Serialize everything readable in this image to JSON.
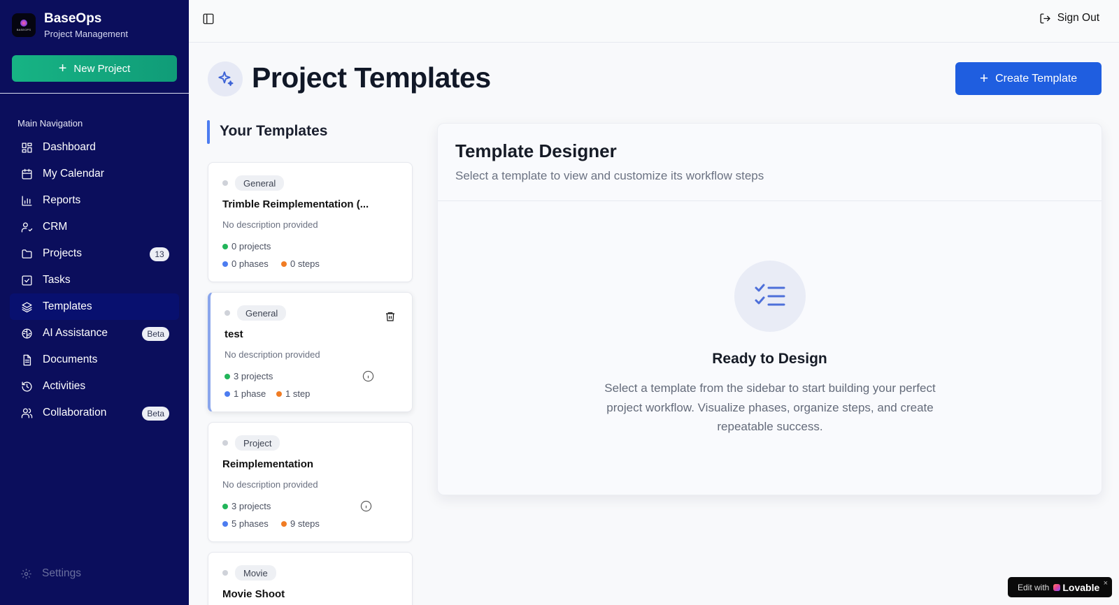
{
  "app": {
    "name": "BaseOps",
    "subtitle": "Project Management",
    "logo_text": "BASEOPS"
  },
  "sidebar": {
    "new_project_label": "New Project",
    "nav_heading": "Main Navigation",
    "items": [
      {
        "label": "Dashboard",
        "icon": "dashboard-icon"
      },
      {
        "label": "My Calendar",
        "icon": "calendar-icon"
      },
      {
        "label": "Reports",
        "icon": "bar-chart-icon"
      },
      {
        "label": "CRM",
        "icon": "user-check-icon"
      },
      {
        "label": "Projects",
        "icon": "folder-icon",
        "badge": "13"
      },
      {
        "label": "Tasks",
        "icon": "checkbox-icon"
      },
      {
        "label": "Templates",
        "icon": "layers-icon",
        "active": true
      },
      {
        "label": "AI Assistance",
        "icon": "brain-icon",
        "badge": "Beta"
      },
      {
        "label": "Documents",
        "icon": "document-icon"
      },
      {
        "label": "Activities",
        "icon": "history-icon"
      },
      {
        "label": "Collaboration",
        "icon": "users-icon",
        "badge": "Beta"
      }
    ],
    "settings_label": "Settings"
  },
  "topbar": {
    "sign_out_label": "Sign Out"
  },
  "page": {
    "title": "Project Templates",
    "create_button_label": "Create Template",
    "section_title": "Your Templates"
  },
  "templates": [
    {
      "tag": "General",
      "name": "Trimble Reimplementation (...",
      "description": "No description provided",
      "projects": "0 projects",
      "phases": "0 phases",
      "steps": "0 steps"
    },
    {
      "tag": "General",
      "name": "test",
      "description": "No description provided",
      "projects": "3 projects",
      "phases": "1 phase",
      "steps": "1 step",
      "selected": true
    },
    {
      "tag": "Project",
      "name": "Reimplementation",
      "description": "No description provided",
      "projects": "3 projects",
      "phases": "5 phases",
      "steps": "9 steps"
    },
    {
      "tag": "Movie",
      "name": "Movie Shoot"
    }
  ],
  "designer": {
    "title": "Template Designer",
    "subtitle": "Select a template to view and customize its workflow steps",
    "empty_title": "Ready to Design",
    "empty_text": "Select a template from the sidebar to start building your perfect project workflow. Visualize phases, organize steps, and create repeatable success."
  },
  "lovable": {
    "prefix": "Edit with",
    "brand": "Lovable",
    "close": "×"
  },
  "colors": {
    "sidebar_bg": "#0b0e5c",
    "accent_green": "#10a37f",
    "primary_blue": "#1f5ee0"
  }
}
